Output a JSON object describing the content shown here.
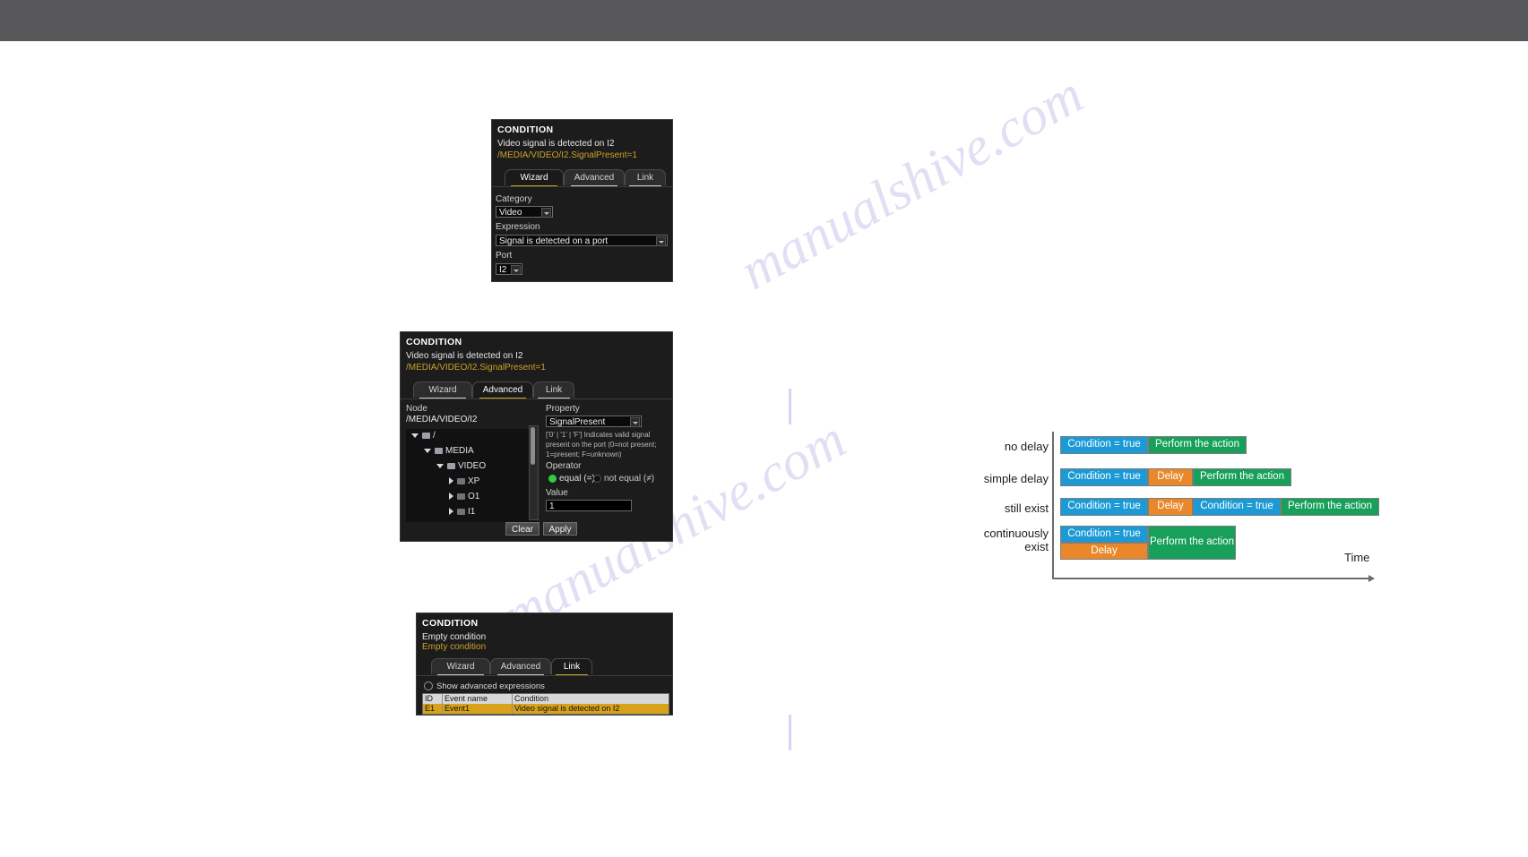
{
  "page": {
    "watermark_1": "manualshive.com",
    "watermark_2": "manualshive.com"
  },
  "panel_wizard": {
    "title": "CONDITION",
    "subtitle": "Video signal is detected on I2",
    "expression_path": "/MEDIA/VIDEO/I2.SignalPresent=1",
    "tabs": [
      {
        "label": "Wizard",
        "active": true
      },
      {
        "label": "Advanced",
        "active": false
      },
      {
        "label": "Link",
        "active": false
      }
    ],
    "category_label": "Category",
    "category_value": "Video",
    "expression_label": "Expression",
    "expression_value": "Signal is detected on a port",
    "port_label": "Port",
    "port_value": "I2"
  },
  "panel_advanced": {
    "title": "CONDITION",
    "subtitle": "Video signal is detected on I2",
    "expression_path": "/MEDIA/VIDEO/I2.SignalPresent=1",
    "tabs": [
      {
        "label": "Wizard",
        "active": false
      },
      {
        "label": "Advanced",
        "active": true
      },
      {
        "label": "Link",
        "active": false
      }
    ],
    "node_label": "Node",
    "node_value": "/MEDIA/VIDEO/I2",
    "tree": [
      {
        "label": "/",
        "depth": 0,
        "expanded": true
      },
      {
        "label": "MEDIA",
        "depth": 1,
        "expanded": true
      },
      {
        "label": "VIDEO",
        "depth": 2,
        "expanded": true
      },
      {
        "label": "XP",
        "depth": 3,
        "expanded": false
      },
      {
        "label": "O1",
        "depth": 3,
        "expanded": false
      },
      {
        "label": "I1",
        "depth": 3,
        "expanded": false
      }
    ],
    "property_label": "Property",
    "property_value": "SignalPresent",
    "property_description": "['0' | '1' | 'F'] Indicates valid signal present on the port (0=not present; 1=present; F=unknown)",
    "operator_label": "Operator",
    "operator_options": [
      {
        "label": "equal (=)",
        "selected": true
      },
      {
        "label": "not equal (≠)",
        "selected": false
      }
    ],
    "value_label": "Value",
    "value_value": "1",
    "clear_button": "Clear",
    "apply_button": "Apply"
  },
  "panel_link": {
    "title": "CONDITION",
    "subtitle": "Empty condition",
    "expression_path": "Empty condition",
    "tabs": [
      {
        "label": "Wizard",
        "active": false
      },
      {
        "label": "Advanced",
        "active": false
      },
      {
        "label": "Link",
        "active": true
      }
    ],
    "show_advanced_label": "Show advanced expressions",
    "table": {
      "columns": [
        "ID",
        "Event name",
        "Condition"
      ],
      "rows": [
        {
          "id": "E1",
          "event_name": "Event1",
          "condition": "Video signal is detected on I2"
        }
      ]
    }
  },
  "timing_diagram": {
    "time_axis_label": "Time",
    "colors": {
      "condition": "#1b9ad6",
      "action": "#17a05a",
      "delay": "#e8882a"
    },
    "rows": [
      {
        "label": "no delay",
        "segments": [
          {
            "text": "Condition = true",
            "kind": "cond"
          },
          {
            "text": "Perform the action",
            "kind": "act"
          }
        ]
      },
      {
        "label": "simple delay",
        "segments": [
          {
            "text": "Condition = true",
            "kind": "cond"
          },
          {
            "text": "Delay",
            "kind": "delay"
          },
          {
            "text": "Perform the action",
            "kind": "act"
          }
        ]
      },
      {
        "label": "still exist",
        "segments": [
          {
            "text": "Condition = true",
            "kind": "cond"
          },
          {
            "text": "Delay",
            "kind": "delay"
          },
          {
            "text": "Condition = true",
            "kind": "cond"
          },
          {
            "text": "Perform the action",
            "kind": "act"
          }
        ]
      },
      {
        "label": "continuously exist",
        "segments": [
          {
            "text": "Condition = true",
            "kind": "cond"
          },
          {
            "text": "Perform the action",
            "kind": "act"
          },
          {
            "text": "Delay",
            "kind": "delay"
          }
        ]
      }
    ]
  }
}
